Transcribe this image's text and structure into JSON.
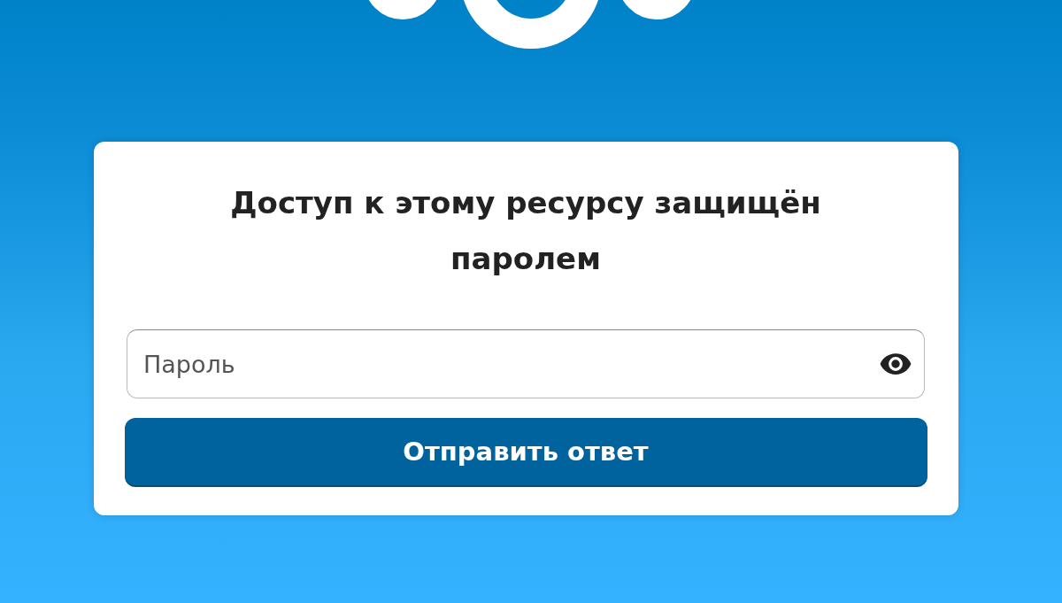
{
  "title": "Доступ к этому ресурсу защищён паролем",
  "password_field": {
    "placeholder": "Пароль"
  },
  "submit_button": {
    "label": "Отправить ответ"
  }
}
